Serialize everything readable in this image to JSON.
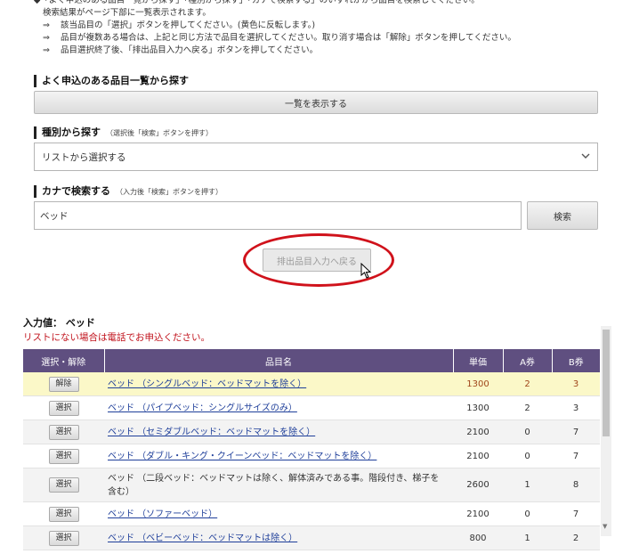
{
  "instructions": {
    "line1": "◆「よく申込のある品目一覧から探す」「種別から探す」「カナで検索する」のいずれかから品目を検索してください。",
    "line2": "検索結果がページ下部に一覧表示されます。",
    "line3": "該当品目の「選択」ボタンを押してください。(黄色に反転します。)",
    "line4": "品目が複数ある場合は、上記と同じ方法で品目を選択してください。取り消す場合は「解除」ボタンを押してください。",
    "line5": "品目選択終了後、「排出品目入力へ戻る」ボタンを押してください。",
    "arrow": "⇒"
  },
  "popular": {
    "title": "よく申込のある品目一覧から探す",
    "button": "一覧を表示する"
  },
  "category": {
    "title": "種別から探す",
    "sub": "（選択後「検索」ボタンを押す）",
    "selected": "リストから選択する",
    "chevron": "chevron-down-icon"
  },
  "kana": {
    "title": "カナで検索する",
    "sub": "（入力後「検索」ボタンを押す）",
    "value": "ベッド",
    "search_button": "検索"
  },
  "back_button": "排出品目入力へ戻る",
  "result": {
    "input_label": "入力値：",
    "input_value": "ベッド",
    "note": "リストにない場合は電話でお申込ください。"
  },
  "table": {
    "headers": [
      "選択・解除",
      "品目名",
      "単価",
      "A券",
      "B券"
    ],
    "rows": [
      {
        "action": "解除",
        "name": "ベッド （シングルベッド：ベッドマットを除く）",
        "link": true,
        "price": "1300",
        "a": "2",
        "b": "3",
        "state": "selected"
      },
      {
        "action": "選択",
        "name": "ベッド （パイプベッド：シングルサイズのみ）",
        "link": true,
        "price": "1300",
        "a": "2",
        "b": "3",
        "state": "normal"
      },
      {
        "action": "選択",
        "name": "ベッド （セミダブルベッド：ベッドマットを除く）",
        "link": true,
        "price": "2100",
        "a": "0",
        "b": "7",
        "state": "alt"
      },
      {
        "action": "選択",
        "name": "ベッド （ダブル・キング・クイーンベッド：ベッドマットを除く）",
        "link": true,
        "price": "2100",
        "a": "0",
        "b": "7",
        "state": "normal"
      },
      {
        "action": "選択",
        "name": "ベッド （二段ベッド：ベッドマットは除く、解体済みである事。階段付き、梯子を含む）",
        "link": false,
        "price": "2600",
        "a": "1",
        "b": "8",
        "state": "alt"
      },
      {
        "action": "選択",
        "name": "ベッド （ソファーベッド）",
        "link": true,
        "price": "2100",
        "a": "0",
        "b": "7",
        "state": "normal"
      },
      {
        "action": "選択",
        "name": "ベッド （ベビーベッド：ベッドマットは除く）",
        "link": true,
        "price": "800",
        "a": "1",
        "b": "2",
        "state": "alt"
      }
    ]
  },
  "colors": {
    "header_bg": "#5f4f80",
    "selected_row": "#fbf8c8",
    "highlight_ellipse": "#d0121b",
    "note_text": "#c0101a"
  }
}
